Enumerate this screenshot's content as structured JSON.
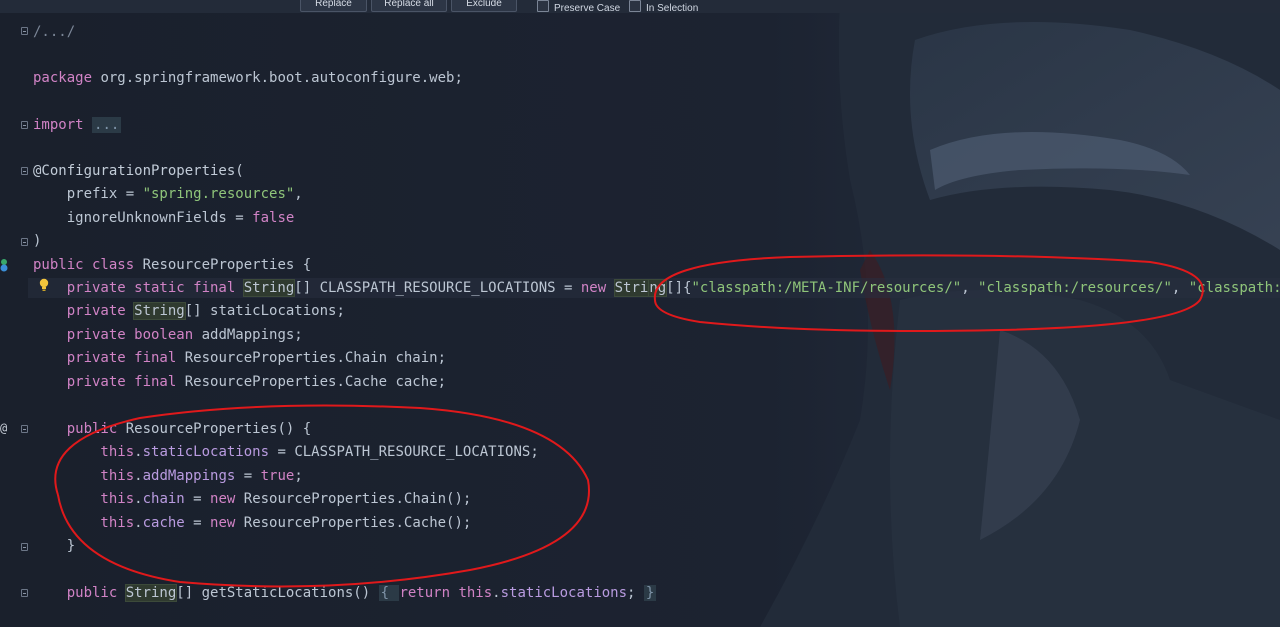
{
  "find_bar": {
    "replace_label": "Replace",
    "replace_all_label": "Replace all",
    "exclude_label": "Exclude",
    "preserve_case_label": "Preserve Case",
    "in_selection_label": "In Selection"
  },
  "colors": {
    "keyword": "#d183c6",
    "string": "#8fc57a",
    "field": "#b99be0",
    "annotation_ellipse": "#e0191b"
  },
  "gutter": {
    "bulb_icon": "lightbulb-icon",
    "override_icon": "override-icon",
    "at_marker": "@"
  },
  "code": {
    "l1": "/.../",
    "l3_kw": "package",
    "l3_name": " org.springframework.boot.autoconfigure.web;",
    "l5_kw": "import",
    "l5_hint": "...",
    "l7": "@ConfigurationProperties(",
    "l8_key": "    prefix = ",
    "l8_val": "\"spring.resources\"",
    "l8_end": ",",
    "l9_key": "    ignoreUnknownFields = ",
    "l9_val": "false",
    "l10": ")",
    "l11_kw": "public class",
    "l11_name": " ResourceProperties {",
    "l12_kw": "    private static final ",
    "l12_type": "String",
    "l12_mid": "[] CLASSPATH_RESOURCE_LOCATIONS = ",
    "l12_new": "new ",
    "l12_type2a": "Stri",
    "l12_type2b": "ng",
    "l12_br": "[]{",
    "l12_s1": "\"classpath:/META-INF/resources/\"",
    "l12_sep1": ", ",
    "l12_s2": "\"classpath:/resources/\"",
    "l12_sep2": ", ",
    "l12_s3": "\"classpath:/stati",
    "l13_kw": "    private ",
    "l13_type": "String",
    "l13_rest": "[] staticLocations;",
    "l14_kw": "    private boolean",
    "l14_rest": " addMappings;",
    "l15_kw": "    private final",
    "l15_rest": " ResourceProperties.Chain chain;",
    "l16_kw": "    private final",
    "l16_rest": " ResourceProperties.Cache cache;",
    "l18_kw": "    public",
    "l18_rest": " ResourceProperties() {",
    "l19_this": "        this",
    "l19_dot": ".",
    "l19_fld": "staticLocations",
    "l19_rest": " = CLASSPATH_RESOURCE_LOCATIONS;",
    "l20_this": "        this",
    "l20_dot": ".",
    "l20_fld": "addMappings",
    "l20_eq": " = ",
    "l20_val": "true",
    "l20_end": ";",
    "l21_this": "        this",
    "l21_dot": ".",
    "l21_fld": "chain",
    "l21_eq": " = ",
    "l21_new": "new",
    "l21_rest": " ResourceProperties.Chain();",
    "l22_this": "        this",
    "l22_dot": ".",
    "l22_fld": "cache",
    "l22_eq": " = ",
    "l22_new": "new",
    "l22_rest": " ResourceProperties.Cache();",
    "l23": "    }",
    "l25_kw": "    public ",
    "l25_type": "String",
    "l25_mid": "[] getStaticLocations() ",
    "l25_ob": "{ ",
    "l25_ret": "return this",
    "l25_dot": ".",
    "l25_fld": "staticLocations",
    "l25_end": "; ",
    "l25_cb": "}"
  }
}
